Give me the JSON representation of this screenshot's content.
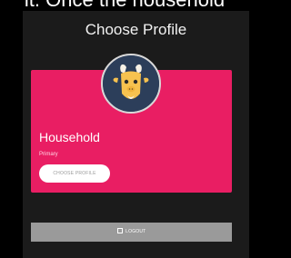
{
  "background_text": "it. Once the household",
  "title": "Choose Profile",
  "profile": {
    "name": "Household",
    "role": "Primary",
    "choose_label": "CHOOSE PROFILE",
    "avatar_icon": "goat-avatar-icon",
    "card_color": "#e91e63"
  },
  "logout": {
    "label": "LOGOUT",
    "icon": "logout-icon"
  }
}
